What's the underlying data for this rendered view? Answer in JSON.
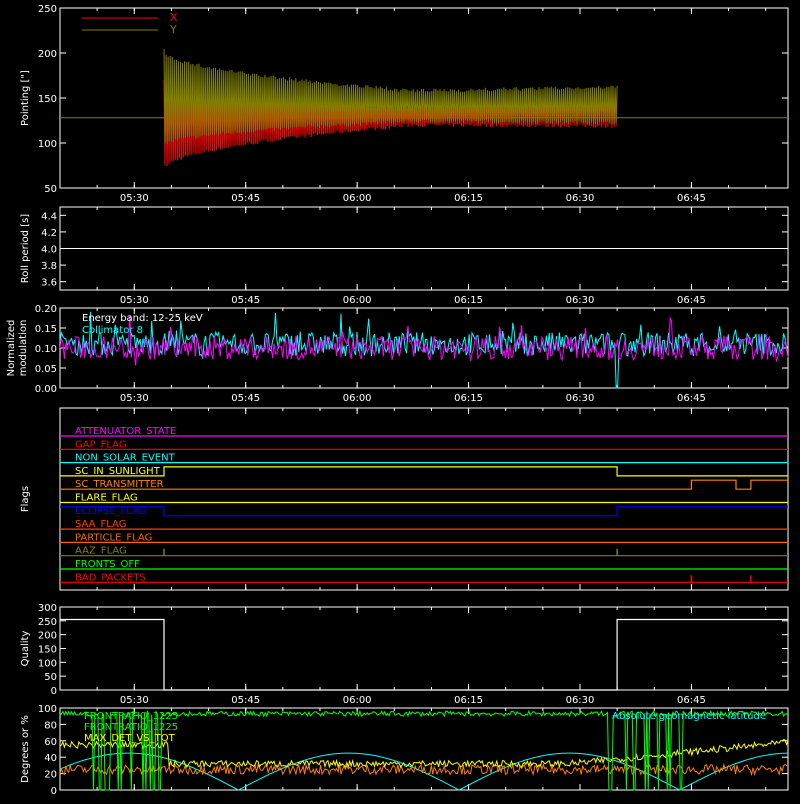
{
  "time_ticks": [
    "05:30",
    "05:45",
    "06:00",
    "06:15",
    "06:30",
    "06:45"
  ],
  "chart_data": [
    {
      "type": "line",
      "ylabel": "Pointing [\"]",
      "ylim": [
        50,
        250
      ],
      "yticks": [
        "50",
        "100",
        "150",
        "200",
        "250"
      ],
      "legend": [
        {
          "name": "X",
          "color": "#ff0000"
        },
        {
          "name": "Y",
          "color": "#808000"
        }
      ],
      "series": [
        {
          "name": "X",
          "color": "#ff0000",
          "baseline": 128,
          "active_start": "05:34",
          "active_end": "06:35",
          "envelope_upper_start": 170,
          "envelope_lower_start": 68,
          "envelope_upper_mid": 140,
          "envelope_lower_mid": 118,
          "envelope_upper_end": 180,
          "envelope_lower_end": 115
        },
        {
          "name": "Y",
          "color": "#808000",
          "baseline": 128,
          "active_start": "05:34",
          "active_end": "06:35",
          "envelope_upper_start": 205,
          "envelope_lower_start": 95,
          "envelope_upper_mid": 160,
          "envelope_lower_mid": 122,
          "envelope_upper_end": 170,
          "envelope_lower_end": 118
        }
      ]
    },
    {
      "type": "line",
      "ylabel": "Roll period [s]",
      "ylim": [
        3.5,
        4.5
      ],
      "yticks": [
        "3.6",
        "3.8",
        "4.0",
        "4.2",
        "4.4"
      ],
      "series": [
        {
          "name": "Roll period",
          "color": "#ffffff",
          "value": 4.0
        }
      ]
    },
    {
      "type": "line",
      "ylabel": "Normalized modulation",
      "ylim": [
        0.0,
        0.2
      ],
      "yticks": [
        "0.00",
        "0.05",
        "0.10",
        "0.15",
        "0.20"
      ],
      "annotations": [
        "Energy band: 12-25 keV",
        "Collimator 8"
      ],
      "series": [
        {
          "name": "",
          "color": "#00ffff",
          "mean": 0.11,
          "dip_time": "06:35",
          "dip_value": 0.0
        },
        {
          "name": "",
          "color": "#ff00ff",
          "mean": 0.1
        }
      ]
    },
    {
      "type": "line",
      "ylabel": "Flags",
      "flags": [
        {
          "name": "ATTENUATOR_STATE",
          "color": "#ff00ff",
          "segments": [
            [
              "05:20",
              "06:58",
              0
            ]
          ]
        },
        {
          "name": "GAP_FLAG",
          "color": "#ff0000",
          "segments": [
            [
              "05:20",
              "06:58",
              0
            ]
          ]
        },
        {
          "name": "NON_SOLAR_EVENT",
          "color": "#00ffff",
          "segments": [
            [
              "05:20",
              "06:58",
              0
            ]
          ]
        },
        {
          "name": "SC_IN_SUNLIGHT",
          "color": "#ffff00",
          "segments": [
            [
              "05:20",
              "05:34",
              0
            ],
            [
              "05:34",
              "06:35",
              1
            ],
            [
              "06:35",
              "06:58",
              0
            ]
          ]
        },
        {
          "name": "SC_TRANSMITTER",
          "color": "#ff8000",
          "segments": [
            [
              "05:20",
              "06:45",
              0
            ],
            [
              "06:45",
              "06:51",
              1
            ],
            [
              "06:51",
              "06:53",
              0
            ],
            [
              "06:53",
              "06:58",
              1
            ]
          ]
        },
        {
          "name": "FLARE_FLAG",
          "color": "#ffff00",
          "segments": [
            [
              "05:20",
              "06:58",
              0
            ]
          ]
        },
        {
          "name": "ECLIPSE_FLAG",
          "color": "#0000ff",
          "segments": [
            [
              "05:20",
              "05:34",
              1
            ],
            [
              "05:34",
              "06:35",
              0
            ],
            [
              "06:35",
              "06:58",
              1
            ]
          ]
        },
        {
          "name": "SAA_FLAG",
          "color": "#ff4000",
          "segments": [
            [
              "05:20",
              "06:58",
              0
            ]
          ]
        },
        {
          "name": "PARTICLE_FLAG",
          "color": "#ff6000",
          "segments": [
            [
              "05:20",
              "06:58",
              0
            ]
          ]
        },
        {
          "name": "AAZ_FLAG",
          "color": "#808000",
          "segments": [
            [
              "05:20",
              "06:58",
              0
            ]
          ],
          "spikes": [
            "05:34",
            "06:35"
          ]
        },
        {
          "name": "FRONTS_OFF",
          "color": "#00ff00",
          "segments": [
            [
              "05:20",
              "06:58",
              0
            ]
          ]
        },
        {
          "name": "BAD_PACKETS",
          "color": "#ff0000",
          "segments": [
            [
              "05:20",
              "06:58",
              0
            ]
          ],
          "spikes": [
            "06:45",
            "06:53"
          ]
        }
      ]
    },
    {
      "type": "line",
      "ylabel": "Quality",
      "ylim": [
        0,
        300
      ],
      "yticks": [
        "0",
        "50",
        "100",
        "150",
        "200",
        "250",
        "300"
      ],
      "series": [
        {
          "name": "Quality",
          "color": "#ffffff",
          "points": [
            [
              "05:20",
              255
            ],
            [
              "05:34",
              255
            ],
            [
              "05:34",
              0
            ],
            [
              "06:35",
              0
            ],
            [
              "06:35",
              255
            ],
            [
              "06:58",
              255
            ]
          ]
        }
      ]
    },
    {
      "type": "line",
      "ylabel": "Degrees or %",
      "ylim": [
        0,
        100
      ],
      "yticks": [
        "0",
        "20",
        "40",
        "60",
        "80",
        "100"
      ],
      "legend": [
        {
          "name": "FRONTRATIO_1225",
          "color": "#00ff00"
        },
        {
          "name": "FRONTRATIO_1225",
          "color": "#00ff00"
        },
        {
          "name": "MAX_DET_VS_TOT",
          "color": "#ffff00"
        },
        {
          "name": "Absolute geomagnetic latitude",
          "color": "#00ffff"
        }
      ],
      "series": [
        {
          "name": "FRONTRATIO_1225",
          "color": "#00ff00",
          "level": 93
        },
        {
          "name": "MAX_DET_VS_TOT",
          "color": "#ffff00",
          "level_start": 55,
          "level_mid": 32,
          "level_end": 58
        },
        {
          "name": "",
          "color": "#ff8000",
          "level": 25
        },
        {
          "name": "Absolute geomagnetic latitude",
          "color": "#00ffff",
          "cycle": "sinusoid",
          "max": 45,
          "min": 0
        }
      ]
    }
  ]
}
